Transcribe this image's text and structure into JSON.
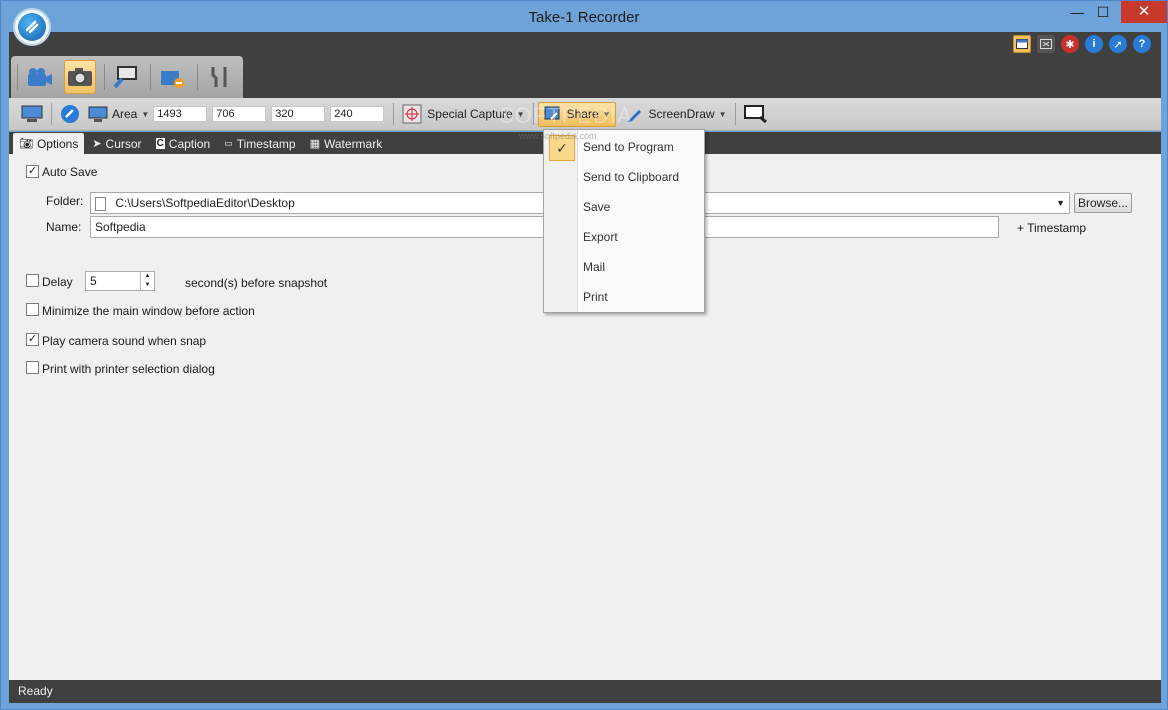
{
  "window": {
    "title": "Take-1 Recorder",
    "minimize": "—",
    "maximize": "☐",
    "close": "✕"
  },
  "subtoolbar": {
    "area_label": "Area",
    "area_x": "1493",
    "area_y": "706",
    "area_w": "320",
    "area_h": "240",
    "special_capture": "Special Capture",
    "share": "Share",
    "screendraw": "ScreenDraw"
  },
  "tabs": [
    {
      "label": "Options",
      "icon": "camera-icon"
    },
    {
      "label": "Cursor",
      "icon": "cursor-icon"
    },
    {
      "label": "Caption",
      "icon": "caption-icon"
    },
    {
      "label": "Timestamp",
      "icon": "timestamp-icon"
    },
    {
      "label": "Watermark",
      "icon": "watermark-icon"
    }
  ],
  "options": {
    "auto_save": "Auto Save",
    "folder_label": "Folder:",
    "folder_value": "C:\\Users\\SoftpediaEditor\\Desktop",
    "browse": "Browse...",
    "name_label": "Name:",
    "name_value": "Softpedia",
    "timestamp_btn": "+ Timestamp",
    "delay_label": "Delay",
    "delay_value": "5",
    "delay_suffix": "second(s) before snapshot",
    "minimize_label": "Minimize the main window before action",
    "camera_sound_label": "Play camera sound when snap",
    "print_label": "Print with printer selection dialog"
  },
  "share_menu": {
    "items": [
      "Send to Program",
      "Send to Clipboard",
      "Save",
      "Export",
      "Mail",
      "Print"
    ],
    "checked_index": 0
  },
  "watermark_text": "SOFTPEDIA",
  "watermark_sub": "www.softpedia.com",
  "status": {
    "text": "Ready"
  }
}
